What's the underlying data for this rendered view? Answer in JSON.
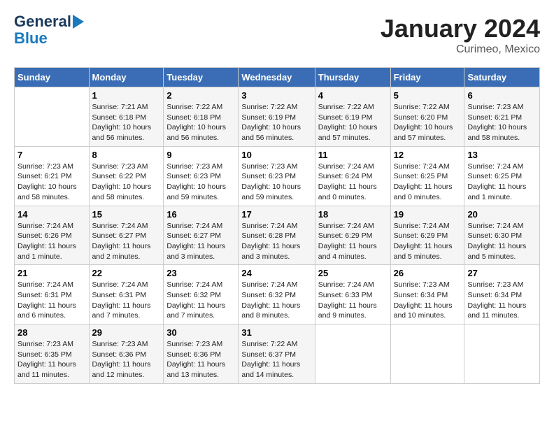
{
  "header": {
    "logo_line1": "General",
    "logo_line2": "Blue",
    "month": "January 2024",
    "location": "Curimeo, Mexico"
  },
  "days_of_week": [
    "Sunday",
    "Monday",
    "Tuesday",
    "Wednesday",
    "Thursday",
    "Friday",
    "Saturday"
  ],
  "weeks": [
    [
      {
        "day": "",
        "sunrise": "",
        "sunset": "",
        "daylight": ""
      },
      {
        "day": "1",
        "sunrise": "Sunrise: 7:21 AM",
        "sunset": "Sunset: 6:18 PM",
        "daylight": "Daylight: 10 hours and 56 minutes."
      },
      {
        "day": "2",
        "sunrise": "Sunrise: 7:22 AM",
        "sunset": "Sunset: 6:18 PM",
        "daylight": "Daylight: 10 hours and 56 minutes."
      },
      {
        "day": "3",
        "sunrise": "Sunrise: 7:22 AM",
        "sunset": "Sunset: 6:19 PM",
        "daylight": "Daylight: 10 hours and 56 minutes."
      },
      {
        "day": "4",
        "sunrise": "Sunrise: 7:22 AM",
        "sunset": "Sunset: 6:19 PM",
        "daylight": "Daylight: 10 hours and 57 minutes."
      },
      {
        "day": "5",
        "sunrise": "Sunrise: 7:22 AM",
        "sunset": "Sunset: 6:20 PM",
        "daylight": "Daylight: 10 hours and 57 minutes."
      },
      {
        "day": "6",
        "sunrise": "Sunrise: 7:23 AM",
        "sunset": "Sunset: 6:21 PM",
        "daylight": "Daylight: 10 hours and 58 minutes."
      }
    ],
    [
      {
        "day": "7",
        "sunrise": "Sunrise: 7:23 AM",
        "sunset": "Sunset: 6:21 PM",
        "daylight": "Daylight: 10 hours and 58 minutes."
      },
      {
        "day": "8",
        "sunrise": "Sunrise: 7:23 AM",
        "sunset": "Sunset: 6:22 PM",
        "daylight": "Daylight: 10 hours and 58 minutes."
      },
      {
        "day": "9",
        "sunrise": "Sunrise: 7:23 AM",
        "sunset": "Sunset: 6:23 PM",
        "daylight": "Daylight: 10 hours and 59 minutes."
      },
      {
        "day": "10",
        "sunrise": "Sunrise: 7:23 AM",
        "sunset": "Sunset: 6:23 PM",
        "daylight": "Daylight: 10 hours and 59 minutes."
      },
      {
        "day": "11",
        "sunrise": "Sunrise: 7:24 AM",
        "sunset": "Sunset: 6:24 PM",
        "daylight": "Daylight: 11 hours and 0 minutes."
      },
      {
        "day": "12",
        "sunrise": "Sunrise: 7:24 AM",
        "sunset": "Sunset: 6:25 PM",
        "daylight": "Daylight: 11 hours and 0 minutes."
      },
      {
        "day": "13",
        "sunrise": "Sunrise: 7:24 AM",
        "sunset": "Sunset: 6:25 PM",
        "daylight": "Daylight: 11 hours and 1 minute."
      }
    ],
    [
      {
        "day": "14",
        "sunrise": "Sunrise: 7:24 AM",
        "sunset": "Sunset: 6:26 PM",
        "daylight": "Daylight: 11 hours and 1 minute."
      },
      {
        "day": "15",
        "sunrise": "Sunrise: 7:24 AM",
        "sunset": "Sunset: 6:27 PM",
        "daylight": "Daylight: 11 hours and 2 minutes."
      },
      {
        "day": "16",
        "sunrise": "Sunrise: 7:24 AM",
        "sunset": "Sunset: 6:27 PM",
        "daylight": "Daylight: 11 hours and 3 minutes."
      },
      {
        "day": "17",
        "sunrise": "Sunrise: 7:24 AM",
        "sunset": "Sunset: 6:28 PM",
        "daylight": "Daylight: 11 hours and 3 minutes."
      },
      {
        "day": "18",
        "sunrise": "Sunrise: 7:24 AM",
        "sunset": "Sunset: 6:29 PM",
        "daylight": "Daylight: 11 hours and 4 minutes."
      },
      {
        "day": "19",
        "sunrise": "Sunrise: 7:24 AM",
        "sunset": "Sunset: 6:29 PM",
        "daylight": "Daylight: 11 hours and 5 minutes."
      },
      {
        "day": "20",
        "sunrise": "Sunrise: 7:24 AM",
        "sunset": "Sunset: 6:30 PM",
        "daylight": "Daylight: 11 hours and 5 minutes."
      }
    ],
    [
      {
        "day": "21",
        "sunrise": "Sunrise: 7:24 AM",
        "sunset": "Sunset: 6:31 PM",
        "daylight": "Daylight: 11 hours and 6 minutes."
      },
      {
        "day": "22",
        "sunrise": "Sunrise: 7:24 AM",
        "sunset": "Sunset: 6:31 PM",
        "daylight": "Daylight: 11 hours and 7 minutes."
      },
      {
        "day": "23",
        "sunrise": "Sunrise: 7:24 AM",
        "sunset": "Sunset: 6:32 PM",
        "daylight": "Daylight: 11 hours and 7 minutes."
      },
      {
        "day": "24",
        "sunrise": "Sunrise: 7:24 AM",
        "sunset": "Sunset: 6:32 PM",
        "daylight": "Daylight: 11 hours and 8 minutes."
      },
      {
        "day": "25",
        "sunrise": "Sunrise: 7:24 AM",
        "sunset": "Sunset: 6:33 PM",
        "daylight": "Daylight: 11 hours and 9 minutes."
      },
      {
        "day": "26",
        "sunrise": "Sunrise: 7:23 AM",
        "sunset": "Sunset: 6:34 PM",
        "daylight": "Daylight: 11 hours and 10 minutes."
      },
      {
        "day": "27",
        "sunrise": "Sunrise: 7:23 AM",
        "sunset": "Sunset: 6:34 PM",
        "daylight": "Daylight: 11 hours and 11 minutes."
      }
    ],
    [
      {
        "day": "28",
        "sunrise": "Sunrise: 7:23 AM",
        "sunset": "Sunset: 6:35 PM",
        "daylight": "Daylight: 11 hours and 11 minutes."
      },
      {
        "day": "29",
        "sunrise": "Sunrise: 7:23 AM",
        "sunset": "Sunset: 6:36 PM",
        "daylight": "Daylight: 11 hours and 12 minutes."
      },
      {
        "day": "30",
        "sunrise": "Sunrise: 7:23 AM",
        "sunset": "Sunset: 6:36 PM",
        "daylight": "Daylight: 11 hours and 13 minutes."
      },
      {
        "day": "31",
        "sunrise": "Sunrise: 7:22 AM",
        "sunset": "Sunset: 6:37 PM",
        "daylight": "Daylight: 11 hours and 14 minutes."
      },
      {
        "day": "",
        "sunrise": "",
        "sunset": "",
        "daylight": ""
      },
      {
        "day": "",
        "sunrise": "",
        "sunset": "",
        "daylight": ""
      },
      {
        "day": "",
        "sunrise": "",
        "sunset": "",
        "daylight": ""
      }
    ]
  ]
}
